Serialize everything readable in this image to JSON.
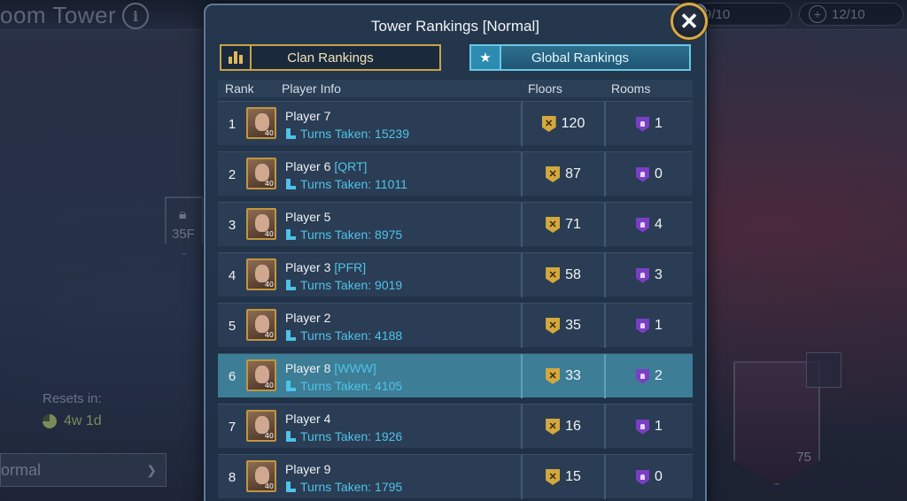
{
  "background": {
    "title": "oom Tower",
    "info_glyph": "i",
    "counter_1": "9/10",
    "counter_2": "12/10",
    "counter_plus": "+",
    "lock_label": "35F",
    "resets_label": "Resets in:",
    "resets_value": "4w 1d",
    "mode_value": "ormal",
    "mode_chevron": "❯",
    "boss_level": "75"
  },
  "modal": {
    "title": "Tower Rankings [Normal]",
    "close_glyph": "✕",
    "tabs": {
      "clan": "Clan Rankings",
      "global": "Global Rankings",
      "active": "global"
    },
    "columns": {
      "rank": "Rank",
      "player_info": "Player Info",
      "floors": "Floors",
      "rooms": "Rooms"
    },
    "turns_prefix": "Turns Taken: ",
    "avatar_level": "40",
    "rows": [
      {
        "rank": "1",
        "name": "Player 7",
        "clan": "",
        "turns": "15239",
        "floors": "120",
        "rooms": "1"
      },
      {
        "rank": "2",
        "name": "Player 6",
        "clan": "[QRT]",
        "turns": "11011",
        "floors": "87",
        "rooms": "0"
      },
      {
        "rank": "3",
        "name": "Player 5",
        "clan": "",
        "turns": "8975",
        "floors": "71",
        "rooms": "4"
      },
      {
        "rank": "4",
        "name": "Player 3",
        "clan": "[PFR]",
        "turns": "9019",
        "floors": "58",
        "rooms": "3"
      },
      {
        "rank": "5",
        "name": "Player 2",
        "clan": "",
        "turns": "4188",
        "floors": "35",
        "rooms": "1"
      },
      {
        "rank": "6",
        "name": "Player 8",
        "clan": "[WWW]",
        "turns": "4105",
        "floors": "33",
        "rooms": "2"
      },
      {
        "rank": "7",
        "name": "Player 4",
        "clan": "",
        "turns": "1926",
        "floors": "16",
        "rooms": "1"
      },
      {
        "rank": "8",
        "name": "Player 9",
        "clan": "",
        "turns": "1795",
        "floors": "15",
        "rooms": "0"
      }
    ],
    "highlighted_rank": "6"
  },
  "colors": {
    "accent_gold": "#d6aa4a",
    "accent_cyan": "#4fc3e8",
    "highlight_row": "#3d7d96",
    "room_purple": "#7a3fc4"
  },
  "icons": {
    "floors": "swords-shield-icon",
    "rooms": "door-shield-icon",
    "turns": "boot-icon",
    "clan_tab": "bar-chart-icon",
    "global_tab": "star-icon",
    "close": "close-icon"
  }
}
